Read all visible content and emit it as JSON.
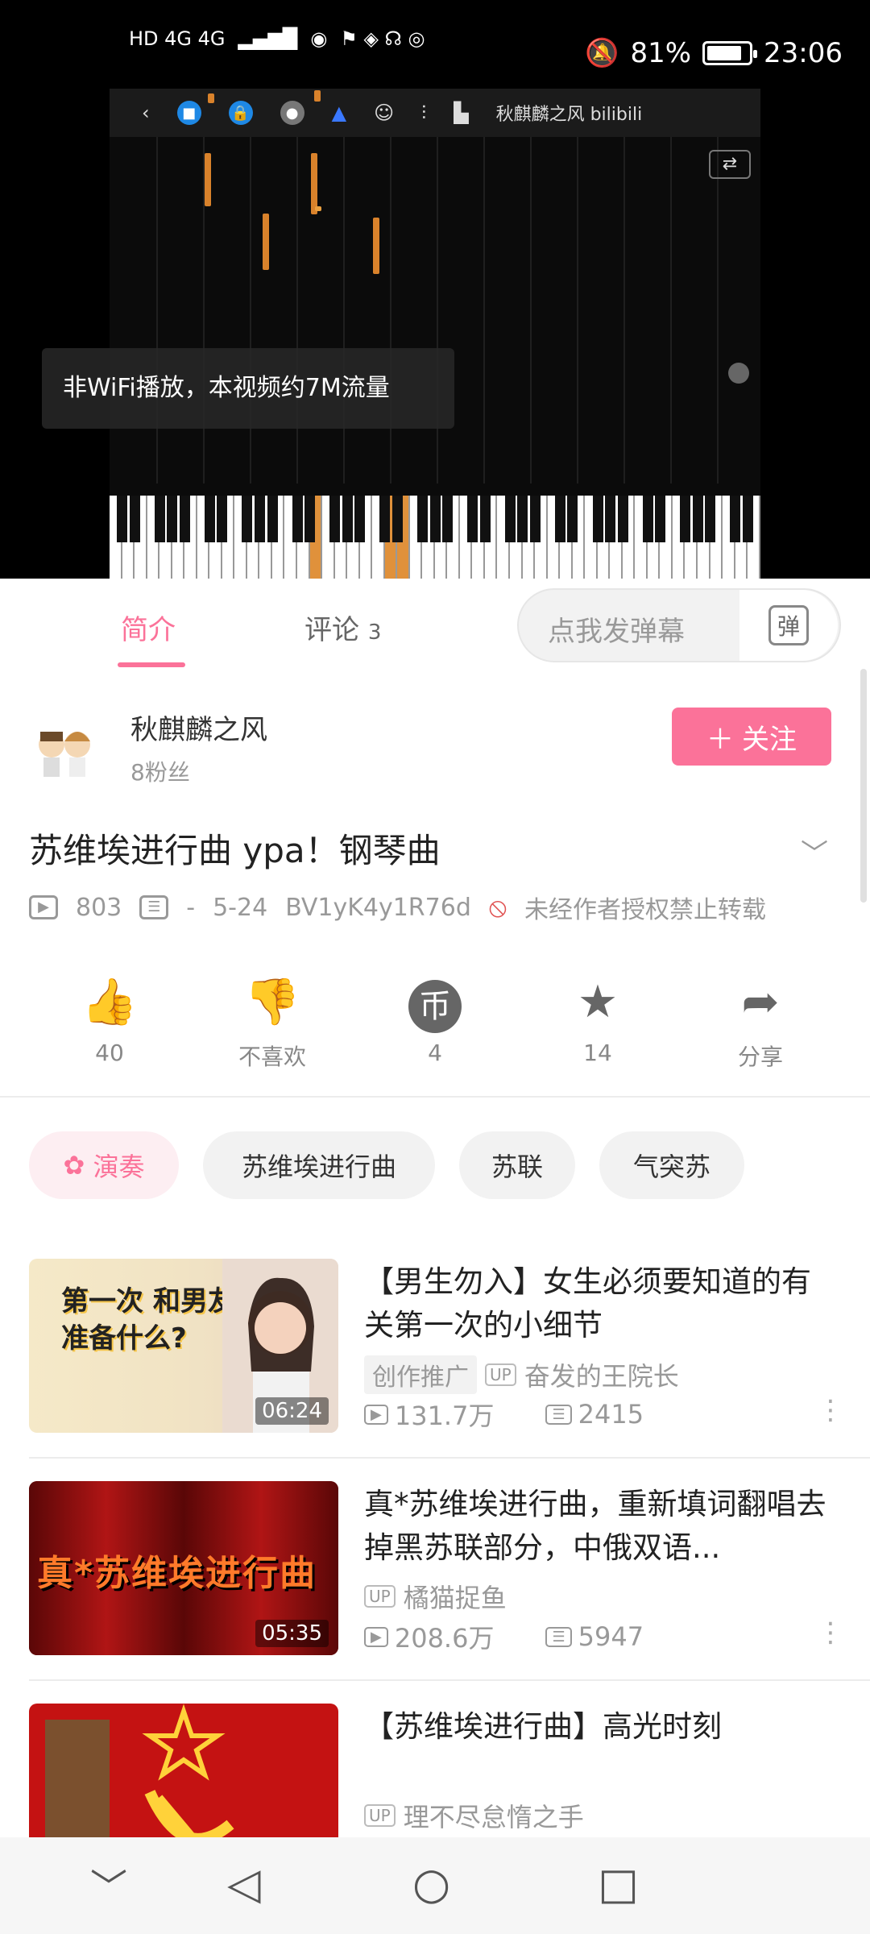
{
  "status_bar": {
    "network": "HD 4G 4G",
    "battery": "81%",
    "battery_level": 0.81,
    "time": "23:06"
  },
  "player": {
    "toast": "非WiFi播放，本视频约7M流量",
    "watermark": "秋麒麟之风 bilibili"
  },
  "tabs": [
    {
      "label": "简介"
    },
    {
      "label": "评论"
    }
  ],
  "comment_count": "3",
  "danmaku": {
    "placeholder": "点我发弹幕",
    "button": "弹"
  },
  "author": {
    "name": "秋麒麟之风",
    "fans": "8粉丝",
    "follow": "关注"
  },
  "video": {
    "title": "苏维埃进行曲  ура！钢琴曲",
    "views": "803",
    "danmaku_count": "-",
    "date": "5-24",
    "bvid": "BV1yK4y1R76d",
    "notice": "未经作者授权禁止转载"
  },
  "actions": [
    {
      "label": "40",
      "icon": "like-icon"
    },
    {
      "label": "不喜欢",
      "icon": "dislike-icon"
    },
    {
      "label": "4",
      "icon": "coin-icon"
    },
    {
      "label": "14",
      "icon": "star-icon"
    },
    {
      "label": "分享",
      "icon": "share-icon"
    }
  ],
  "tags": [
    {
      "label": "演奏"
    },
    {
      "label": "苏维埃进行曲"
    },
    {
      "label": "苏联"
    },
    {
      "label": "气突苏"
    }
  ],
  "recommendations": [
    {
      "title": "【男生勿入】女生必须要知道的有关第一次的小细节",
      "promo": "创作推广",
      "uploader": "奋发的王院长",
      "views": "131.7万",
      "danmaku": "2415",
      "duration": "06:24",
      "thumb_text": "第一次 和男友约会 要准备什么?"
    },
    {
      "title": "真*苏维埃进行曲，重新填词翻唱去掉黑苏联部分，中俄双语...",
      "uploader": "橘猫捉鱼",
      "views": "208.6万",
      "danmaku": "5947",
      "duration": "05:35",
      "thumb_text": "真*苏维埃进行曲"
    },
    {
      "title": "【苏维埃进行曲】高光时刻",
      "uploader": "理不尽怠惰之手"
    }
  ],
  "colors": {
    "accent": "#fb7299",
    "note": "#d9822b"
  }
}
